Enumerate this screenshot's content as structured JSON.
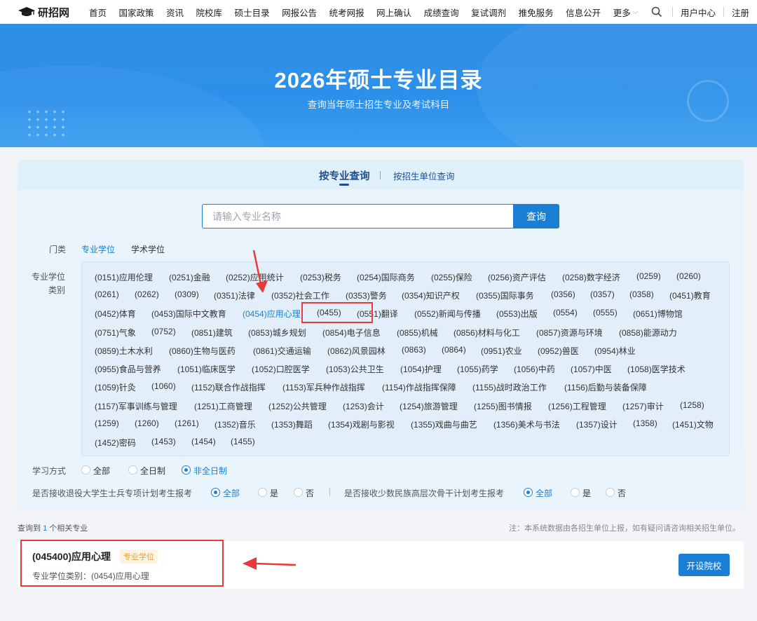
{
  "nav": {
    "logo_text": "研招网",
    "items": [
      "首页",
      "国家政策",
      "资讯",
      "院校库",
      "硕士目录",
      "网报公告",
      "统考网报",
      "网上确认",
      "成绩查询",
      "复试调剂",
      "推免服务",
      "信息公开"
    ],
    "more": "更多",
    "user_center": "用户中心",
    "logout": "注册"
  },
  "banner": {
    "title": "2026年硕士专业目录",
    "subtitle": "查询当年硕士招生专业及考试科目"
  },
  "tabs": {
    "by_major": "按专业查询",
    "by_unit": "按招生单位查询"
  },
  "search": {
    "placeholder": "请输入专业名称",
    "button": "查询"
  },
  "filters": {
    "category_label": "门类",
    "category_options": [
      "专业学位",
      "学术学位"
    ],
    "type_label_1": "专业学位",
    "type_label_2": "类别",
    "study_label": "学习方式",
    "study_options": [
      "全部",
      "全日制",
      "非全日制"
    ],
    "veteran_label": "是否接收退役大学生士兵专项计划考生报考",
    "veteran_options": [
      "全部",
      "是",
      "否"
    ],
    "minority_label": "是否接收少数民族高层次骨干计划考生报考",
    "minority_options": [
      "全部",
      "是",
      "否"
    ]
  },
  "categories": [
    [
      "(0151)应用伦理",
      "(0251)金融",
      "(0252)应用统计",
      "(0253)税务",
      "(0254)国际商务",
      "(0255)保险",
      "(0256)资产评估",
      "(0258)数字经济",
      "(0259)",
      "(0260)"
    ],
    [
      "(0261)",
      "(0262)",
      "(0309)",
      "(0351)法律",
      "(0352)社会工作",
      "(0353)警务",
      "(0354)知识产权",
      "(0355)国际事务",
      "(0356)",
      "(0357)",
      "(0358)",
      "(0451)教育"
    ],
    [
      "(0452)体育",
      "(0453)国际中文教育",
      "(0454)应用心理",
      "(0455)",
      "(0551)翻译",
      "(0552)新闻与传播",
      "(0553)出版",
      "(0554)",
      "(0555)",
      "(0651)博物馆"
    ],
    [
      "(0751)气象",
      "(0752)",
      "(0851)建筑",
      "(0853)城乡规划",
      "(0854)电子信息",
      "(0855)机械",
      "(0856)材料与化工",
      "(0857)资源与环境",
      "(0858)能源动力"
    ],
    [
      "(0859)土木水利",
      "(0860)生物与医药",
      "(0861)交通运输",
      "(0862)风景园林",
      "(0863)",
      "(0864)",
      "(0951)农业",
      "(0952)兽医",
      "(0954)林业"
    ],
    [
      "(0955)食品与营养",
      "(1051)临床医学",
      "(1052)口腔医学",
      "(1053)公共卫生",
      "(1054)护理",
      "(1055)药学",
      "(1056)中药",
      "(1057)中医",
      "(1058)医学技术"
    ],
    [
      "(1059)针灸",
      "(1060)",
      "(1152)联合作战指挥",
      "(1153)军兵种作战指挥",
      "(1154)作战指挥保障",
      "(1155)战时政治工作",
      "(1156)后勤与装备保障"
    ],
    [
      "(1157)军事训练与管理",
      "(1251)工商管理",
      "(1252)公共管理",
      "(1253)会计",
      "(1254)旅游管理",
      "(1255)图书情报",
      "(1256)工程管理",
      "(1257)审计",
      "(1258)"
    ],
    [
      "(1259)",
      "(1260)",
      "(1261)",
      "(1352)音乐",
      "(1353)舞蹈",
      "(1354)戏剧与影视",
      "(1355)戏曲与曲艺",
      "(1356)美术与书法",
      "(1357)设计",
      "(1358)",
      "(1451)文物"
    ],
    [
      "(1452)密码",
      "(1453)",
      "(1454)",
      "(1455)"
    ]
  ],
  "results": {
    "count_prefix": "查询到",
    "count": "1",
    "count_suffix": "个相关专业",
    "note": "注：本系统数据由各招生单位上报，如有疑问请咨询相关招生单位。",
    "item_title": "(045400)应用心理",
    "item_tag": "专业学位",
    "item_sub": "专业学位类别：(0454)应用心理",
    "item_button": "开设院校"
  },
  "colors": {
    "accent": "#1a7fd4",
    "banner": "#2c90ea",
    "annotation": "#e83a3a"
  }
}
